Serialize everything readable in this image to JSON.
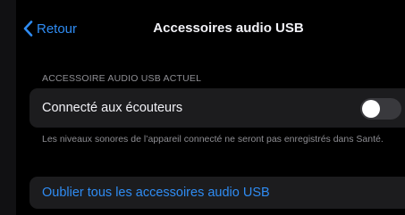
{
  "colors": {
    "accent": "#2f8cf3",
    "background": "#000000",
    "group_background": "#1c1c1e",
    "primary_text": "#f2f2f7",
    "secondary_text": "#8e8e93",
    "switch_off": "#39393d"
  },
  "navbar": {
    "back_icon": "chevron-left-icon",
    "back_label": "Retour",
    "title": "Accessoires audio USB"
  },
  "section": {
    "header": "ACCESSOIRE AUDIO USB ACTUEL",
    "toggle_row": {
      "label": "Connecté aux écouteurs",
      "value": "off"
    },
    "footer": "Les niveaux sonores de l’appareil connecté ne seront pas enregistrés dans Santé."
  },
  "action": {
    "label": "Oublier tous les accessoires audio USB"
  }
}
